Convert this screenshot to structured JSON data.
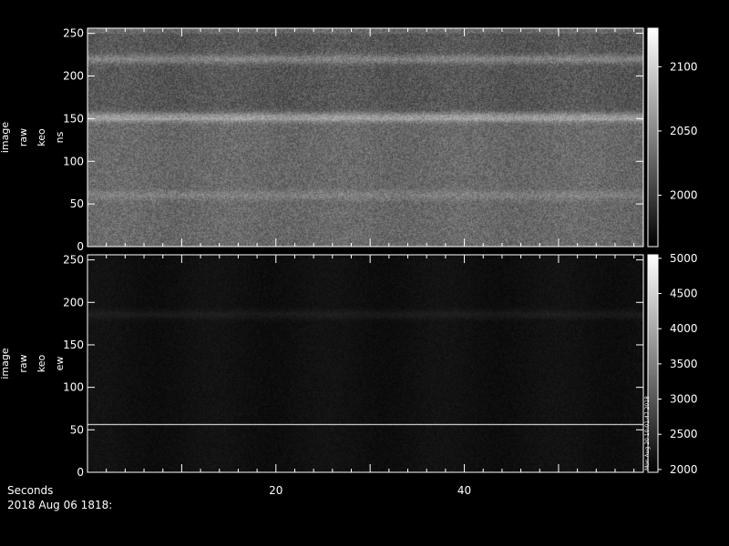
{
  "chart_data": [
    {
      "type": "heatmap",
      "title": "",
      "ylabel": [
        "image",
        "raw",
        "keo",
        "ns"
      ],
      "xlim": [
        0,
        59
      ],
      "ylim": [
        0,
        256
      ],
      "xticks": [
        20,
        40
      ],
      "yticks": [
        0,
        50,
        100,
        150,
        200,
        250
      ],
      "colorbar": {
        "ticks": [
          2000,
          2050,
          2100
        ],
        "range": [
          1960,
          2130
        ]
      },
      "base_level": 2030,
      "features": [
        {
          "kind": "horizontal_band",
          "y": 152,
          "level": 2075
        },
        {
          "kind": "horizontal_band",
          "y": 220,
          "level": 2060
        },
        {
          "kind": "horizontal_band",
          "y": 60,
          "level": 2045
        },
        {
          "kind": "dark_region",
          "y": [
            150,
            250
          ],
          "level": 2005
        }
      ],
      "grid": false,
      "colormap": "gray"
    },
    {
      "type": "heatmap",
      "title": "",
      "ylabel": [
        "image",
        "raw",
        "keo",
        "ew"
      ],
      "xlim": [
        0,
        59
      ],
      "ylim": [
        0,
        256
      ],
      "xticks": [
        20,
        40
      ],
      "yticks": [
        0,
        50,
        100,
        150,
        200,
        250
      ],
      "colorbar": {
        "ticks": [
          2000,
          2500,
          3000,
          3500,
          4000,
          4500,
          5000
        ],
        "range": [
          1960,
          5050
        ]
      },
      "base_level": 2150,
      "features": [
        {
          "kind": "horizontal_line",
          "y": 56,
          "level": 5000
        },
        {
          "kind": "horizontal_band",
          "y": 186,
          "level": 2300
        }
      ],
      "grid": false,
      "colormap": "gray"
    }
  ],
  "footer": {
    "x_label": "Seconds",
    "date_line": "2018 Aug 06 1818:",
    "side_note": "Mon Aug 20 10:01:47 2018"
  }
}
